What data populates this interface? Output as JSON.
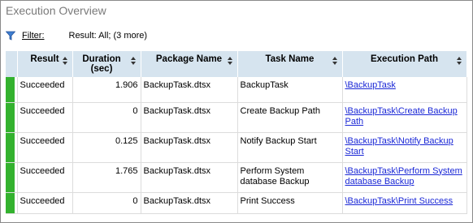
{
  "panel": {
    "title": "Execution Overview",
    "filter_label": "Filter:",
    "filter_value": "Result: All;  (3 more)"
  },
  "columns": [
    {
      "label": "Result"
    },
    {
      "label": "Duration\n(sec)"
    },
    {
      "label": "Package Name"
    },
    {
      "label": "Task Name"
    },
    {
      "label": "Execution Path"
    }
  ],
  "rows": [
    {
      "status_color": "#33b22e",
      "result": "Succeeded",
      "duration": "1.906",
      "package": "BackupTask.dtsx",
      "task": "BackupTask",
      "path": "\\BackupTask"
    },
    {
      "status_color": "#33b22e",
      "result": "Succeeded",
      "duration": "0",
      "package": "BackupTask.dtsx",
      "task": "Create Backup Path",
      "path": "\\BackupTask\\Create Backup Path"
    },
    {
      "status_color": "#33b22e",
      "result": "Succeeded",
      "duration": "0.125",
      "package": "BackupTask.dtsx",
      "task": "Notify Backup Start",
      "path": "\\BackupTask\\Notify Backup Start"
    },
    {
      "status_color": "#33b22e",
      "result": "Succeeded",
      "duration": "1.765",
      "package": "BackupTask.dtsx",
      "task": "Perform System database Backup",
      "path": "\\BackupTask\\Perform System database Backup"
    },
    {
      "status_color": "#33b22e",
      "result": "Succeeded",
      "duration": "0",
      "package": "BackupTask.dtsx",
      "task": "Print Success",
      "path": "\\BackupTask\\Print Success"
    }
  ],
  "icons": {
    "filter": "filter-funnel-icon",
    "sort": "sort-arrows-icon"
  },
  "colors": {
    "header_bg": "#d6e4ef",
    "success": "#33b22e",
    "link": "#1a27d6",
    "title": "#7a7a7a"
  }
}
